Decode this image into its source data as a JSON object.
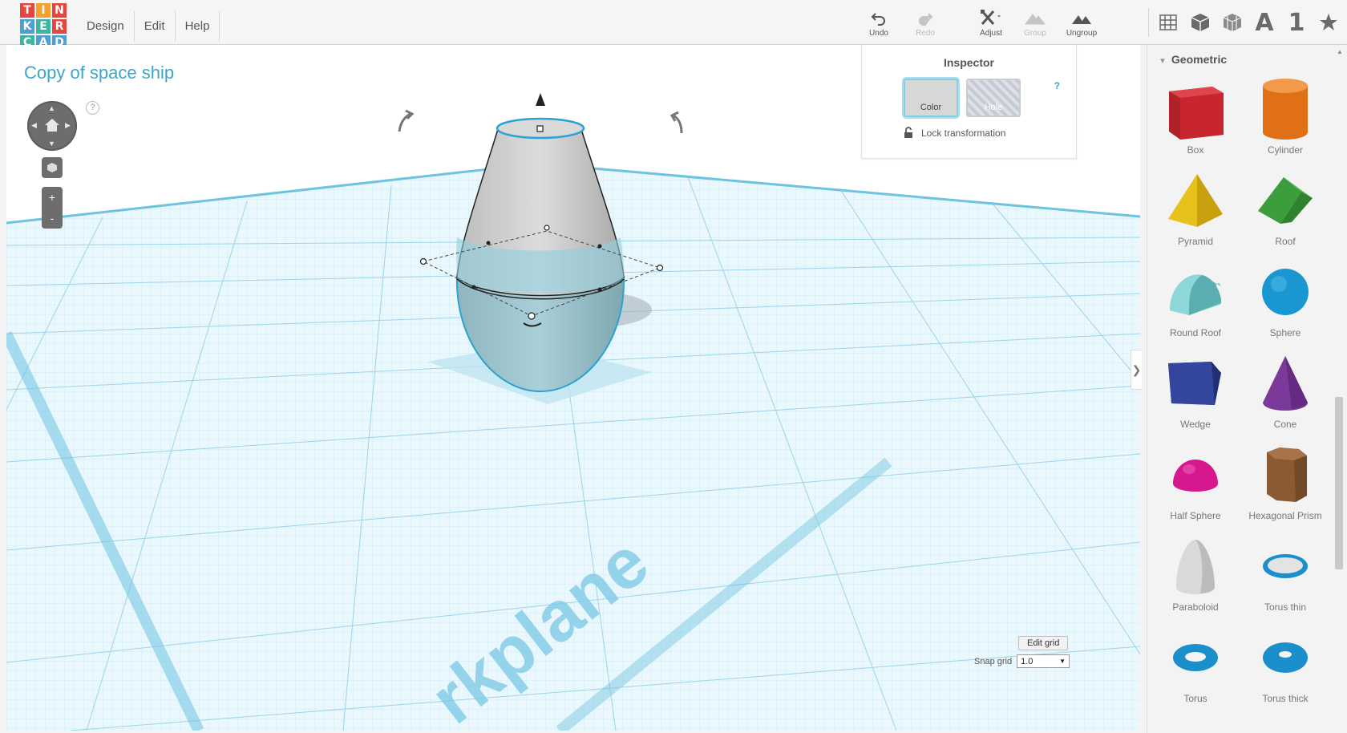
{
  "logo": {
    "letters": [
      "T",
      "I",
      "N",
      "K",
      "E",
      "R",
      "C",
      "A",
      "D"
    ],
    "colors": [
      "#e6453d",
      "#f4a12c",
      "#e6453d",
      "#4e9ed8",
      "#3db6a1",
      "#e6453d",
      "#3db6a1",
      "#4e9ed8",
      "#4e9ed8"
    ]
  },
  "menu": {
    "design": "Design",
    "edit": "Edit",
    "help": "Help"
  },
  "tools": {
    "undo": "Undo",
    "redo": "Redo",
    "adjust": "Adjust",
    "group": "Group",
    "ungroup": "Ungroup"
  },
  "view_icons": {
    "letter": "A",
    "number": "1"
  },
  "design_title": "Copy of space ship",
  "nav": {
    "help": "?",
    "zoom_in": "+",
    "zoom_out": "-"
  },
  "inspector": {
    "title": "Inspector",
    "help": "?",
    "color_label": "Color",
    "hole_label": "Hole",
    "lock_label": "Lock transformation"
  },
  "workplane_text": "rkplane",
  "grid": {
    "edit_label": "Edit grid",
    "snap_label": "Snap grid",
    "snap_value": "1.0"
  },
  "panel": {
    "header": "Geometric",
    "shapes": [
      {
        "name": "Box",
        "color": "#c8262f"
      },
      {
        "name": "Cylinder",
        "color": "#e07016"
      },
      {
        "name": "Pyramid",
        "color": "#e8c21c"
      },
      {
        "name": "Roof",
        "color": "#3b9d3c"
      },
      {
        "name": "Round Roof",
        "color": "#6fc2c4"
      },
      {
        "name": "Sphere",
        "color": "#1a97d1"
      },
      {
        "name": "Wedge",
        "color": "#2b3a8c"
      },
      {
        "name": "Cone",
        "color": "#7b3a9a"
      },
      {
        "name": "Half Sphere",
        "color": "#d6178d"
      },
      {
        "name": "Hexagonal Prism",
        "color": "#8b5a32"
      },
      {
        "name": "Paraboloid",
        "color": "#d9d9d9"
      },
      {
        "name": "Torus thin",
        "color": "#1a8fcb"
      },
      {
        "name": "Torus",
        "color": "#1a8fcb"
      },
      {
        "name": "Torus thick",
        "color": "#1a8fcb"
      }
    ]
  }
}
